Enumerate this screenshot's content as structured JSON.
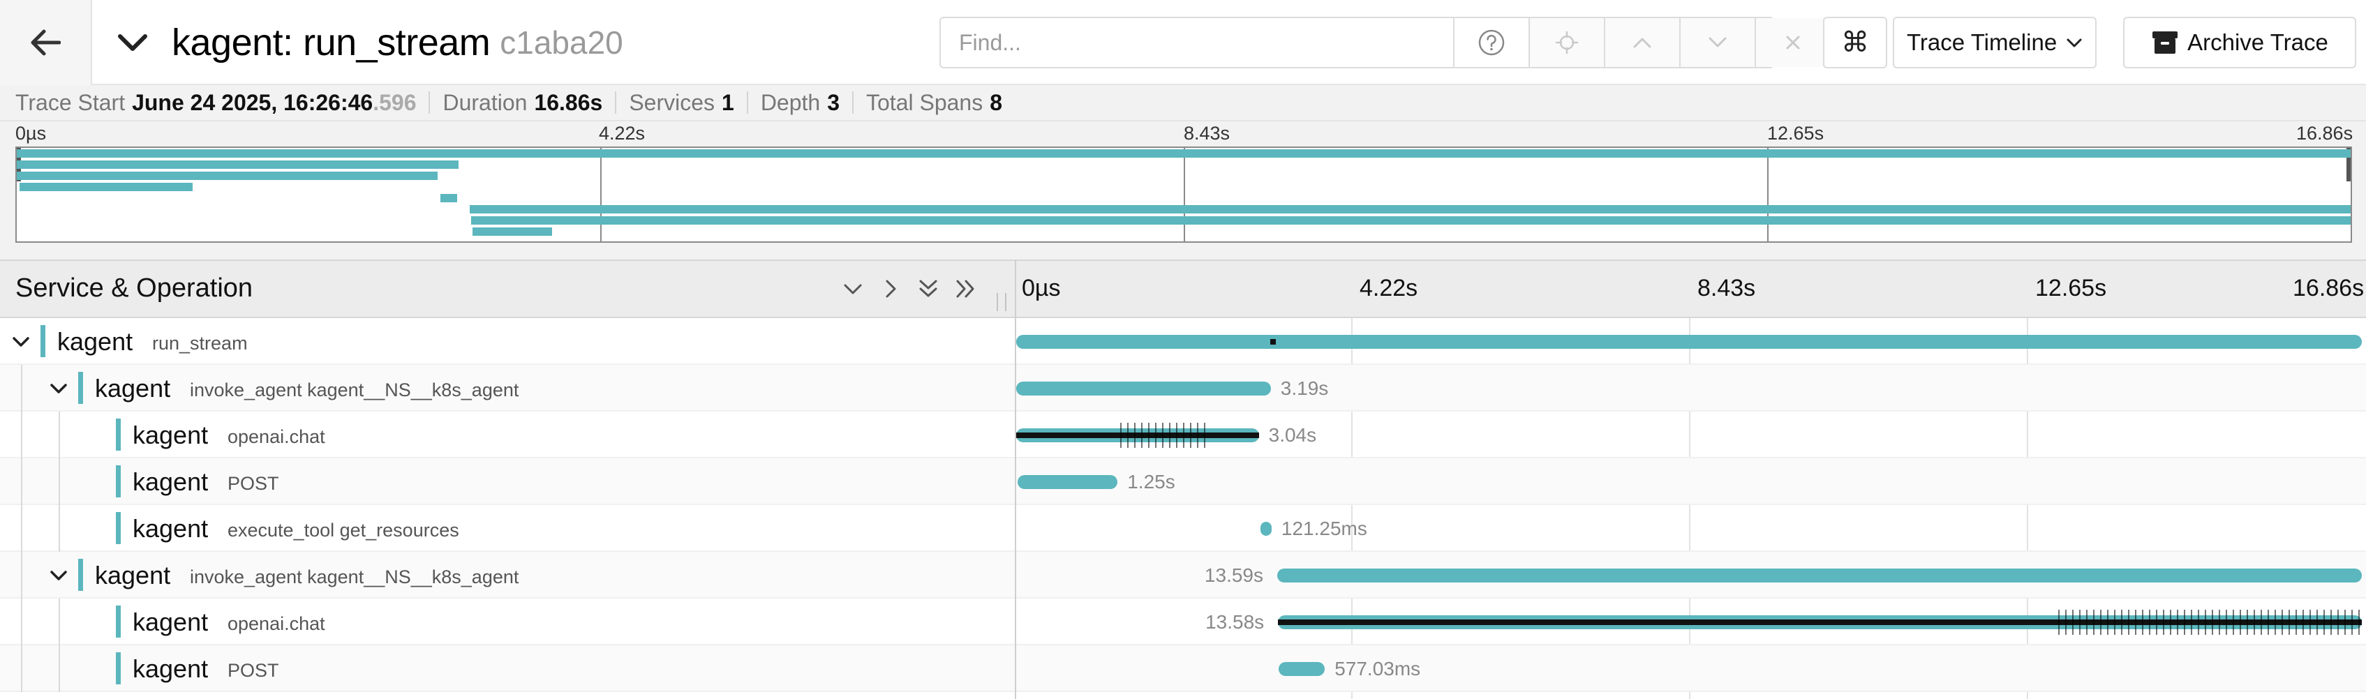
{
  "header": {
    "title": "kagent: run_stream",
    "trace_id": "c1aba20",
    "find_placeholder": "Find...",
    "view_select": "Trace Timeline",
    "archive_label": "Archive Trace",
    "cmd_symbol": "⌘"
  },
  "meta": {
    "trace_start_label": "Trace Start",
    "trace_start_value": "June 24 2025, 16:26:46",
    "trace_start_ms": ".596",
    "duration_label": "Duration",
    "duration_value": "16.86s",
    "services_label": "Services",
    "services_value": "1",
    "depth_label": "Depth",
    "depth_value": "3",
    "total_spans_label": "Total Spans",
    "total_spans_value": "8"
  },
  "minimap": {
    "ticks": [
      "0µs",
      "4.22s",
      "8.43s",
      "12.65s",
      "16.86s"
    ]
  },
  "timeline": {
    "column_title": "Service & Operation",
    "ticks": [
      "0µs",
      "4.22s",
      "8.43s",
      "12.65s",
      "16.86s"
    ],
    "total_duration_s": 16.86
  },
  "spans": [
    {
      "service": "kagent",
      "operation": "run_stream",
      "depth": 0,
      "has_children": true,
      "start_s": 0,
      "duration_s": 16.86,
      "label": ""
    },
    {
      "service": "kagent",
      "operation": "invoke_agent kagent__NS__k8s_agent",
      "depth": 1,
      "has_children": true,
      "start_s": 0,
      "duration_s": 3.19,
      "label": "3.19s"
    },
    {
      "service": "kagent",
      "operation": "openai.chat",
      "depth": 2,
      "has_children": false,
      "start_s": 0,
      "duration_s": 3.04,
      "label": "3.04s"
    },
    {
      "service": "kagent",
      "operation": "POST",
      "depth": 2,
      "has_children": false,
      "start_s": 0.02,
      "duration_s": 1.25,
      "label": "1.25s"
    },
    {
      "service": "kagent",
      "operation": "execute_tool get_resources",
      "depth": 2,
      "has_children": false,
      "start_s": 3.06,
      "duration_s": 0.12125,
      "label": "121.25ms"
    },
    {
      "service": "kagent",
      "operation": "invoke_agent kagent__NS__k8s_agent",
      "depth": 1,
      "has_children": true,
      "start_s": 3.27,
      "duration_s": 13.59,
      "label": "13.59s"
    },
    {
      "service": "kagent",
      "operation": "openai.chat",
      "depth": 2,
      "has_children": false,
      "start_s": 3.28,
      "duration_s": 13.58,
      "label": "13.58s"
    },
    {
      "service": "kagent",
      "operation": "POST",
      "depth": 2,
      "has_children": false,
      "start_s": 3.29,
      "duration_s": 0.57703,
      "label": "577.03ms"
    }
  ],
  "colors": {
    "span": "#5bb6bd",
    "log_marks": "#111111"
  }
}
